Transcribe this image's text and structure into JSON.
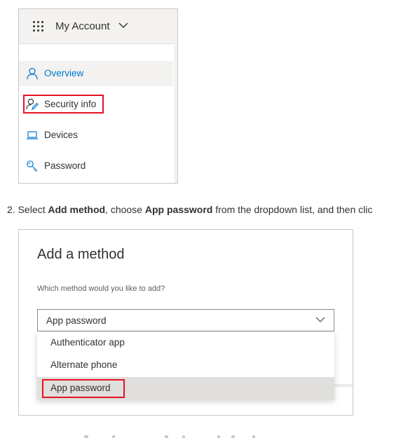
{
  "my_account_panel": {
    "title": "My Account",
    "nav_items": [
      {
        "label": "Overview",
        "icon": "person-icon",
        "selected": true
      },
      {
        "label": "Security info",
        "icon": "person-edit-icon",
        "highlighted": true
      },
      {
        "label": "Devices",
        "icon": "laptop-icon"
      },
      {
        "label": "Password",
        "icon": "key-icon"
      }
    ]
  },
  "step2": {
    "number": "2.",
    "t1": "Select ",
    "b1": "Add method",
    "t2": ", choose ",
    "b2": "App password",
    "t3": " from the dropdown list, and then clic"
  },
  "add_method_dialog": {
    "title": "Add a method",
    "question": "Which method would you like to add?",
    "selected_value": "App password",
    "options": [
      "Authenticator app",
      "Alternate phone",
      "App password"
    ],
    "highlighted_option": "App password"
  },
  "colors": {
    "accent": "#0078d4",
    "highlight_box": "#e81123",
    "header_bg": "#f3f2f1",
    "selected_option_bg": "#e1dfdd"
  }
}
